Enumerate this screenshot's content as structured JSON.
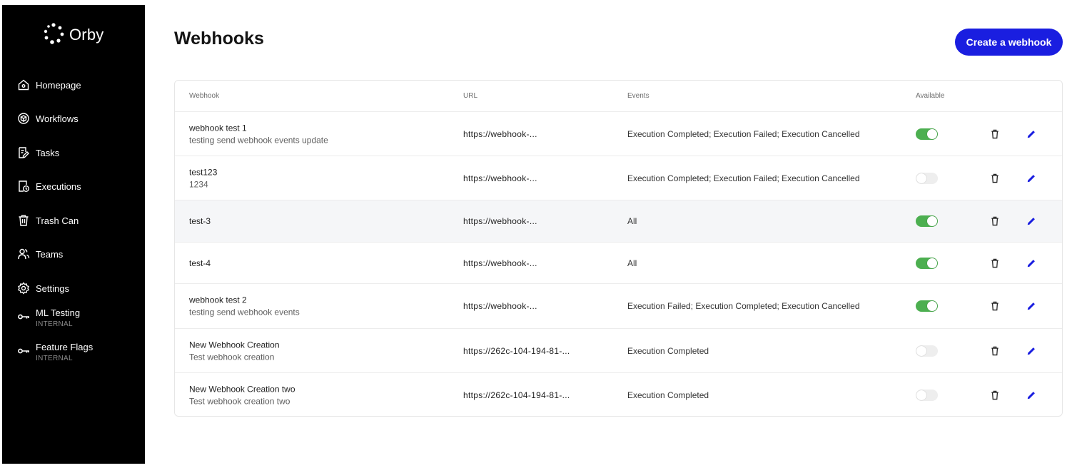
{
  "app": {
    "name": "Orby"
  },
  "sidebar": {
    "items": [
      {
        "label": "Homepage",
        "icon": "home-icon"
      },
      {
        "label": "Workflows",
        "icon": "cube-icon"
      },
      {
        "label": "Tasks",
        "icon": "task-edit-icon"
      },
      {
        "label": "Executions",
        "icon": "document-clock-icon"
      },
      {
        "label": "Trash Can",
        "icon": "trash-icon"
      },
      {
        "label": "Teams",
        "icon": "people-icon"
      },
      {
        "label": "Settings",
        "icon": "gear-icon"
      },
      {
        "label": "ML Testing",
        "sub": "INTERNAL",
        "icon": "key-icon"
      },
      {
        "label": "Feature Flags",
        "sub": "INTERNAL",
        "icon": "key-icon"
      }
    ]
  },
  "header": {
    "title": "Webhooks",
    "create_label": "Create a webhook"
  },
  "table": {
    "columns": [
      "Webhook",
      "URL",
      "Events",
      "Available"
    ],
    "rows": [
      {
        "name": "webhook test 1",
        "description": "testing send webhook events update",
        "url": "https://webhook-...",
        "events": "Execution Completed; Execution Failed; Execution Cancelled",
        "available": true
      },
      {
        "name": "test123",
        "description": "1234",
        "url": "https://webhook-...",
        "events": "Execution Completed; Execution Failed; Execution Cancelled",
        "available": false
      },
      {
        "name": "test-3",
        "description": "",
        "url": "https://webhook-...",
        "events": "All",
        "available": true
      },
      {
        "name": "test-4",
        "description": "",
        "url": "https://webhook-...",
        "events": "All",
        "available": true
      },
      {
        "name": "webhook test 2",
        "description": "testing send webhook events",
        "url": "https://webhook-...",
        "events": "Execution Failed; Execution Completed; Execution Cancelled",
        "available": true
      },
      {
        "name": "New Webhook Creation",
        "description": "Test webhook creation",
        "url": "https://262c-104-194-81-...",
        "events": "Execution Completed",
        "available": false
      },
      {
        "name": "New Webhook Creation two",
        "description": "Test webhook creation two",
        "url": "https://262c-104-194-81-...",
        "events": "Execution Completed",
        "available": false
      }
    ]
  },
  "colors": {
    "sidebar_bg": "#000000",
    "primary": "#1a1ee0",
    "toggle_on": "#4caf50",
    "toggle_off": "#eeeeee",
    "edit_icon": "#1a1ee0"
  }
}
